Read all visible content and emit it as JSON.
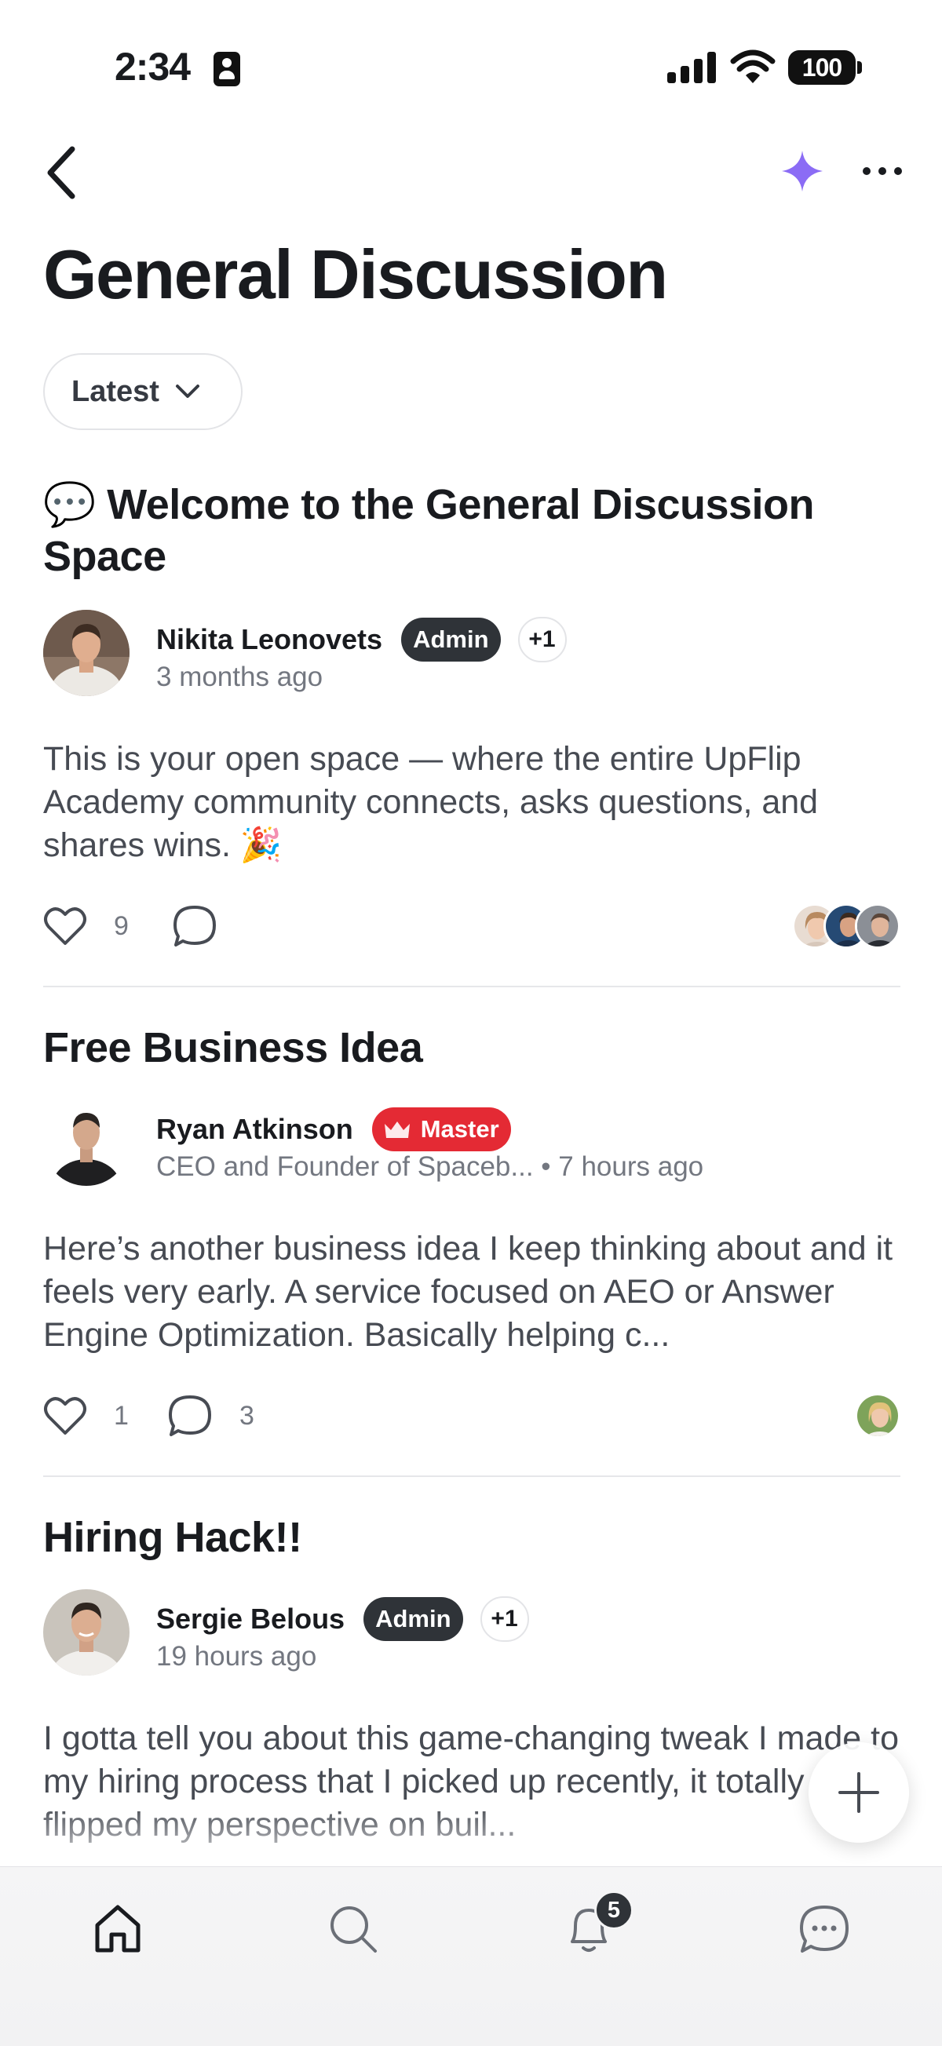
{
  "status_bar": {
    "time": "2:34",
    "battery": "100"
  },
  "nav": {
    "back_icon": "chevron-left-icon",
    "ai_icon": "sparkle-icon",
    "more_icon": "ellipsis-icon"
  },
  "page": {
    "title": "General Discussion",
    "sort_label": "Latest"
  },
  "posts": [
    {
      "emoji": "💬",
      "title": "Welcome to the General Discussion Space",
      "author": "Nikita Leonovets",
      "badge": "Admin",
      "extra_badges": "+1",
      "meta": "3 months ago",
      "body": "This is your open space — where the entire UpFlip Academy community connects, asks questions, and shares wins. 🎉",
      "likes": "9",
      "comments": ""
    },
    {
      "title": "Free Business Idea",
      "author": "Ryan Atkinson",
      "badge": "Master",
      "meta": "CEO and Founder of Spaceb... • 7 hours ago",
      "body": "Here’s another business idea I keep thinking about and it feels very early. A service focused on AEO or Answer Engine Optimization. Basically helping c...",
      "likes": "1",
      "comments": "3"
    },
    {
      "title": "Hiring Hack!!",
      "author": "Sergie Belous",
      "badge": "Admin",
      "extra_badges": "+1",
      "meta": "19 hours ago",
      "body": "I gotta tell you about this game-changing tweak I made to my hiring process that I picked up recently, it totally flipped my perspective on buil..."
    }
  ],
  "tab_bar": {
    "items": [
      "home-icon",
      "search-icon",
      "bell-icon",
      "chat-icon"
    ],
    "notification_count": "5"
  },
  "colors": {
    "accent": "#8b6cf5",
    "admin_badge": "#2f3338",
    "master_badge": "#e42a34"
  }
}
